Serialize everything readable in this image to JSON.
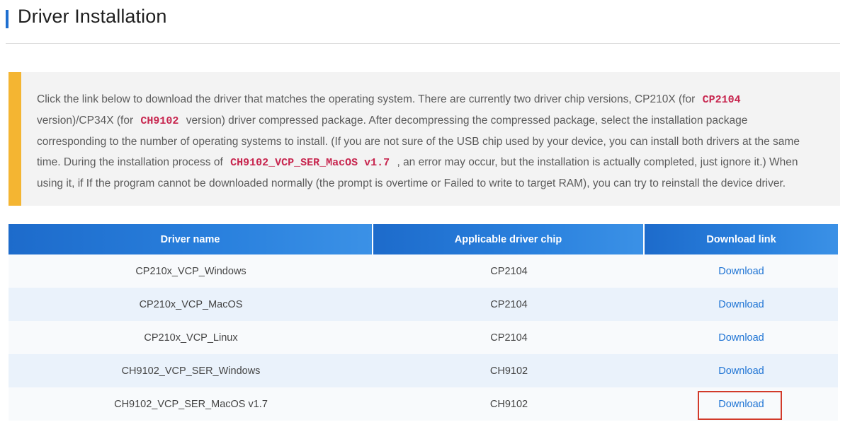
{
  "page": {
    "title": "Driver Installation"
  },
  "notice": {
    "part1": "Click the link below to download the driver that matches the operating system. There are currently two driver chip versions, CP210X (for",
    "code1": "CP2104",
    "part2": "version)/CP34X (for",
    "code2": "CH9102",
    "part3": "version) driver compressed package. After decompressing the compressed package, select the installation package corresponding to the number of operating systems to install. (If you are not sure of the USB chip used by your device, you can install both drivers at the same time. During the installation process of",
    "code3": "CH9102_VCP_SER_MacOS v1.7",
    "part4": ", an error may occur, but the installation is actually completed, just ignore it.) When using it, if If the program cannot be downloaded normally (the prompt is overtime or Failed to write to target RAM), you can try to reinstall the device driver."
  },
  "table": {
    "headers": [
      "Driver name",
      "Applicable driver chip",
      "Download link"
    ],
    "rows": [
      {
        "name": "CP210x_VCP_Windows",
        "chip": "CP2104",
        "link": "Download"
      },
      {
        "name": "CP210x_VCP_MacOS",
        "chip": "CP2104",
        "link": "Download"
      },
      {
        "name": "CP210x_VCP_Linux",
        "chip": "CP2104",
        "link": "Download"
      },
      {
        "name": "CH9102_VCP_SER_Windows",
        "chip": "CH9102",
        "link": "Download"
      },
      {
        "name": "CH9102_VCP_SER_MacOS v1.7",
        "chip": "CH9102",
        "link": "Download"
      }
    ]
  },
  "colors": {
    "accent_blue": "#1e6fd0",
    "notice_bar": "#f4b532",
    "code_red": "#c7254e",
    "link_blue": "#1f74d4",
    "highlight_red": "#d23a2a"
  }
}
